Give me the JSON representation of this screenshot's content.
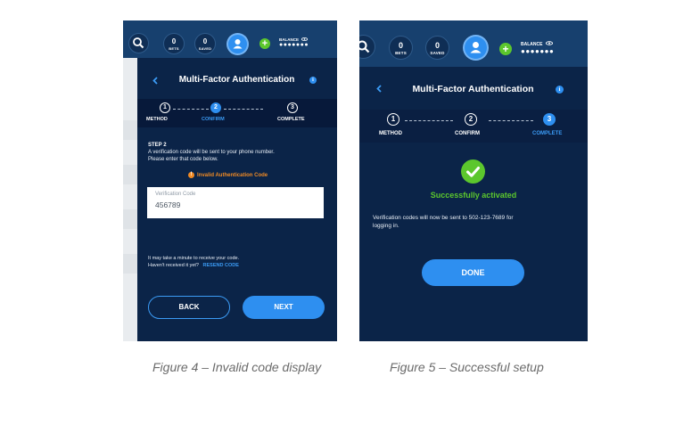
{
  "figure4": {
    "caption": "Figure 4 – Invalid code display",
    "header": {
      "bets_count": "0",
      "bets_label": "BETS",
      "saved_count": "0",
      "saved_label": "SAVED",
      "balance_label": "BALANCE",
      "balance_value": "●●●●●●●"
    },
    "title": "Multi-Factor Authentication",
    "steps": [
      {
        "number": "1",
        "label": "METHOD",
        "state": "done"
      },
      {
        "number": "2",
        "label": "CONFIRM",
        "state": "active"
      },
      {
        "number": "3",
        "label": "COMPLETE",
        "state": "pending"
      }
    ],
    "step_heading": "STEP 2",
    "instructions_line1": "A verification code will be sent to your phone number.",
    "instructions_line2": "Please enter that code below.",
    "error_text": "Invalid Authentication Code",
    "field": {
      "label": "Verification Code",
      "value": "456789"
    },
    "resend_line1": "It may take a minute to receive your code.",
    "resend_line2": "Haven't received it yet?",
    "resend_link": "RESEND CODE",
    "back_button": "BACK",
    "next_button": "NEXT"
  },
  "figure5": {
    "caption": "Figure 5 – Successful setup",
    "header": {
      "bets_count": "0",
      "bets_label": "BETS",
      "saved_count": "0",
      "saved_label": "SAVED",
      "balance_label": "BALANCE",
      "balance_value": "●●●●●●●"
    },
    "title": "Multi-Factor Authentication",
    "steps": [
      {
        "number": "1",
        "label": "METHOD",
        "state": "done"
      },
      {
        "number": "2",
        "label": "CONFIRM",
        "state": "done"
      },
      {
        "number": "3",
        "label": "COMPLETE",
        "state": "active"
      }
    ],
    "success_text": "Successfully activated",
    "message_line1": "Verification codes will now be sent to 502-123-7689 for",
    "message_line2": "logging in.",
    "done_button": "DONE"
  },
  "icons": {
    "search": "search-icon",
    "user": "user-icon",
    "plus": "plus-icon",
    "eye": "eye-icon",
    "back": "chevron-left-icon",
    "info": "info-icon",
    "error": "exclamation-icon",
    "check": "check-icon"
  },
  "colors": {
    "accent": "#2e8ff0",
    "panel": "#0b2448",
    "header": "#17406e",
    "success": "#5cc72d",
    "error": "#f08a24"
  }
}
